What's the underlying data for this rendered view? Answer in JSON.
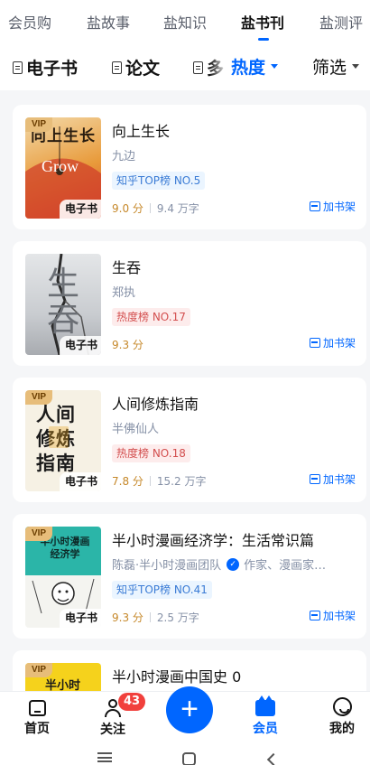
{
  "top_tabs": [
    "会员购",
    "盐故事",
    "盐知识",
    "盐书刊",
    "盐测评"
  ],
  "active_top_tab": "盐书刊",
  "filters": {
    "ebook": "电子书",
    "paper": "论文",
    "truncated": "多",
    "sort": "热度",
    "screen": "筛选"
  },
  "books": [
    {
      "title": "向上生长",
      "author": "九边",
      "badge": "知乎TOP榜 NO.5",
      "badge_style": "blue",
      "score": "9.0 分",
      "readers": "9.4 万字",
      "vip": "VIP",
      "cover_label": "电子书",
      "cover_text": "向上生长",
      "cover_sub": "Grow",
      "action": "加书架"
    },
    {
      "title": "生吞",
      "author": "郑执",
      "badge": "热度榜 NO.17",
      "badge_style": "red",
      "score": "9.3 分",
      "readers": "",
      "vip": "",
      "cover_label": "电子书",
      "cover_text": "生吞",
      "action": "加书架"
    },
    {
      "title": "人间修炼指南",
      "author": "半佛仙人",
      "badge": "热度榜 NO.18",
      "badge_style": "red",
      "score": "7.8 分",
      "readers": "15.2 万字",
      "vip": "VIP",
      "cover_label": "电子书",
      "cover_text": "人间修炼指南",
      "action": "加书架"
    },
    {
      "title": "半小时漫画经济学：生活常识篇",
      "author": "陈磊·半小时漫画团队",
      "author_note": "作家、漫画家…",
      "badge": "知乎TOP榜 NO.41",
      "badge_style": "blue",
      "score": "9.3 分",
      "readers": "2.5 万字",
      "vip": "VIP",
      "cover_label": "电子书",
      "cover_text": "半小时漫画经济学",
      "action": "加书架"
    },
    {
      "title": "半小时漫画中国史 0",
      "vip": "VIP",
      "cover_text": "半小时"
    }
  ],
  "bottom_nav": {
    "home": "首页",
    "follow": "关注",
    "follow_count": "43",
    "fab": "+",
    "member": "会员",
    "mine": "我的"
  },
  "icons": {
    "home": "home-icon",
    "follow": "follow-icon",
    "member": "member-icon",
    "mine": "mine-icon",
    "shelf": "bookshelf-icon",
    "verified": "verified-icon"
  },
  "colors": {
    "accent": "#0066ff",
    "vip": "#e7bd7a",
    "score": "#c6882a",
    "badge_red": "#d34f4f",
    "badge_blue": "#3a7bd5",
    "notification": "#f1403c"
  }
}
